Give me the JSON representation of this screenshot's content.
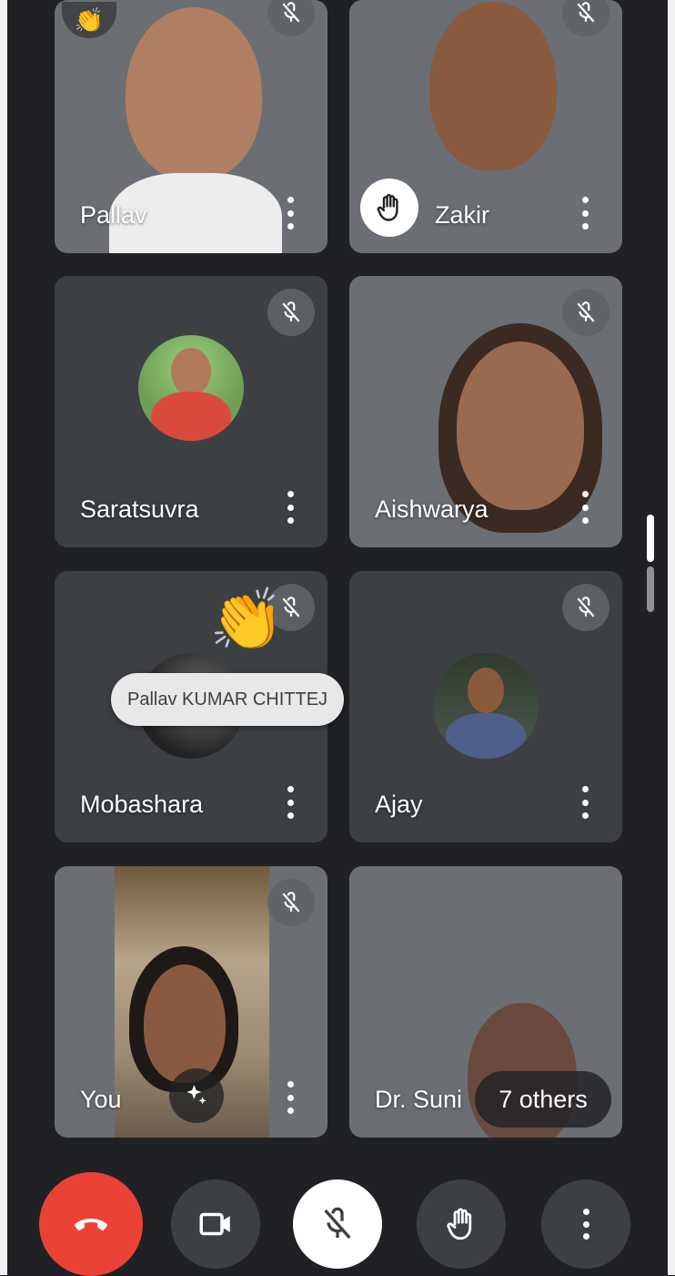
{
  "participants": [
    {
      "name": "Pallav",
      "muted": true,
      "reaction": "clap"
    },
    {
      "name": "Zakir",
      "muted": true,
      "hand_raised": true
    },
    {
      "name": "Saratsuvra",
      "muted": true,
      "avatar": true
    },
    {
      "name": "Aishwarya",
      "muted": true
    },
    {
      "name": "Mobashara",
      "muted": true,
      "avatar": true
    },
    {
      "name": "Ajay",
      "muted": true,
      "avatar": true
    },
    {
      "name": "You",
      "muted": true
    },
    {
      "name": "Dr. Suni"
    }
  ],
  "reaction_popup": {
    "name": "Pallav KUMAR CHITTEJ",
    "icon": "clapping-hands-emoji"
  },
  "others_badge": "7 others",
  "controls": [
    {
      "name": "end-call",
      "icon": "phone-hangup-icon",
      "color": "#ea4335"
    },
    {
      "name": "camera",
      "icon": "video-camera-icon"
    },
    {
      "name": "microphone",
      "icon": "mic-off-icon",
      "state": "muted"
    },
    {
      "name": "raise-hand",
      "icon": "hand-icon"
    },
    {
      "name": "more-options",
      "icon": "more-vertical-icon"
    }
  ],
  "colors": {
    "background": "#202124",
    "tile": "#3c4043",
    "accent_red": "#ea4335"
  }
}
